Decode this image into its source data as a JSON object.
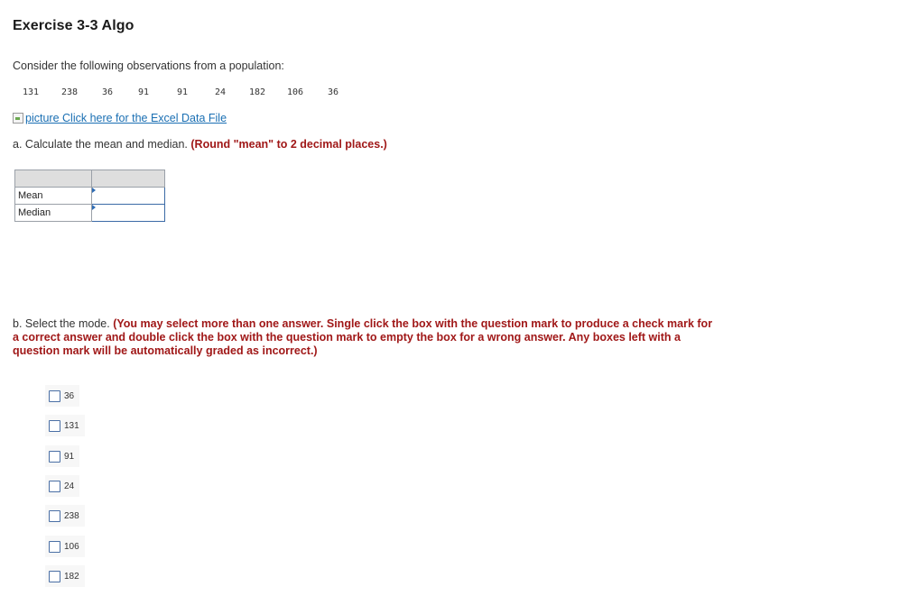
{
  "exercise": {
    "title": "Exercise 3-3 Algo",
    "intro": "Consider the following observations from a population:",
    "observations": [
      "131",
      "238",
      "36",
      "91",
      "91",
      "24",
      "182",
      "106",
      "36"
    ],
    "excel_link": {
      "icon_alt": "picture",
      "label": "Click here for the Excel Data File"
    }
  },
  "part_a": {
    "prefix": "a.",
    "text": "Calculate the mean and median.",
    "instruction": "(Round \"mean\" to 2 decimal places.)",
    "rows": [
      {
        "label": "Mean",
        "value": ""
      },
      {
        "label": "Median",
        "value": ""
      }
    ]
  },
  "part_b": {
    "prefix": "b.",
    "text": "Select the mode.",
    "instruction": "(You may select more than one answer. Single click the box with the question mark to produce a check mark for a correct answer and double click the box with the question mark to empty the box for a wrong answer. Any boxes left with a question mark will be automatically graded as incorrect.)",
    "options": [
      "36",
      "131",
      "91",
      "24",
      "238",
      "106",
      "182"
    ]
  },
  "colors": {
    "link": "#1a6fb3",
    "instruction": "#a01818",
    "input_border": "#3b6aa6"
  }
}
